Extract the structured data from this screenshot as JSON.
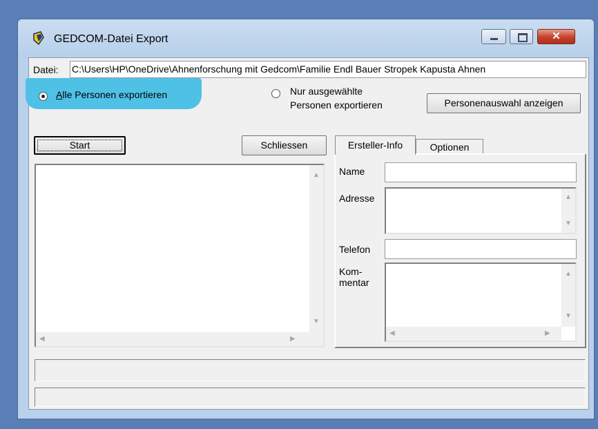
{
  "window": {
    "title": "GEDCOM-Datei Export",
    "close_glyph": "✕"
  },
  "file": {
    "label": "Datei:",
    "path": "C:\\Users\\HP\\OneDrive\\Ahnenforschung mit Gedcom\\Familie Endl Bauer Stropek Kapusta Ahnen"
  },
  "export_mode": {
    "all_persons": "Alle Personen exportieren",
    "selected_line1": "Nur ausgewählte",
    "selected_line2": "Personen exportieren",
    "selected_value": "all"
  },
  "buttons": {
    "show_selection": "Personenauswahl anzeigen",
    "start": "Start",
    "close": "Schliessen"
  },
  "tabs": [
    {
      "label": "Ersteller-Info",
      "active": true
    },
    {
      "label": "Optionen",
      "active": false
    }
  ],
  "creator_info": {
    "name_label": "Name",
    "address_label": "Adresse",
    "phone_label": "Telefon",
    "comment_label_line1": "Kom-",
    "comment_label_line2": "mentar",
    "name_value": "",
    "address_value": "",
    "phone_value": "",
    "comment_value": ""
  },
  "colors": {
    "highlight": "#4fc1e6",
    "window_frame": "#b9d1ea",
    "close_button": "#c4412b"
  }
}
